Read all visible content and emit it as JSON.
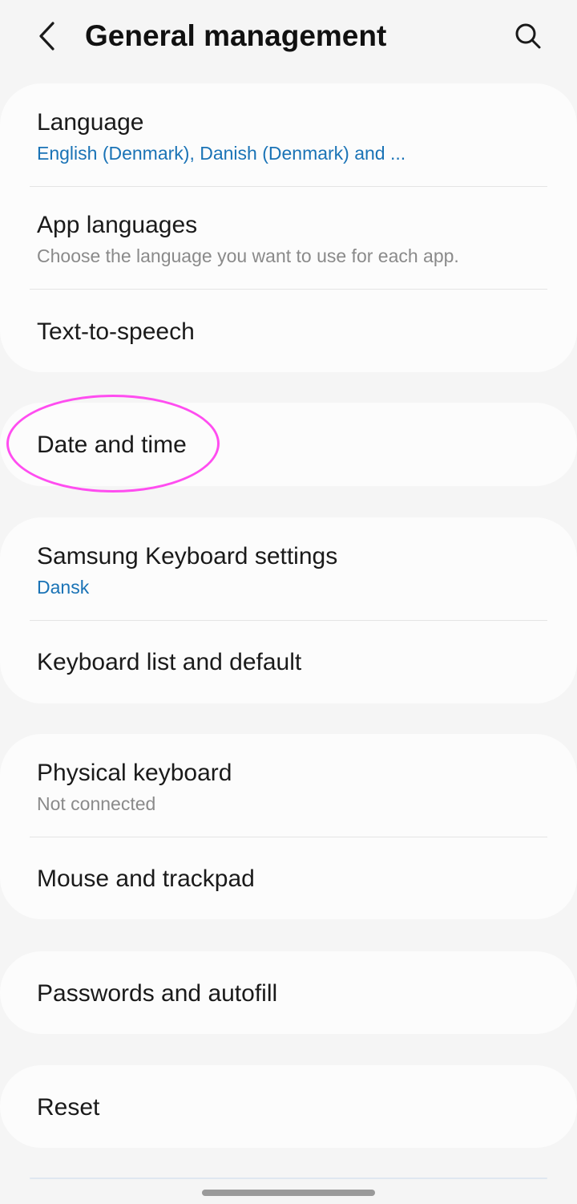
{
  "header": {
    "title": "General management",
    "back_icon": "chevron-left-icon",
    "search_icon": "search-icon"
  },
  "colors": {
    "background": "#f5f5f5",
    "card": "#fcfcfc",
    "subtitle_blue": "#1a73b6",
    "subtitle_gray": "#8a8a8a",
    "highlight": "#ff4df0"
  },
  "groups": [
    {
      "items": [
        {
          "title": "Language",
          "subtitle": "English (Denmark), Danish (Denmark) and ..."
        },
        {
          "title": "App languages",
          "subtitle": "Choose the language you want to use for each app."
        },
        {
          "title": "Text-to-speech"
        }
      ]
    },
    {
      "items": [
        {
          "title": "Date and time"
        }
      ]
    },
    {
      "items": [
        {
          "title": "Samsung Keyboard settings",
          "subtitle": "Dansk"
        },
        {
          "title": "Keyboard list and default"
        }
      ]
    },
    {
      "items": [
        {
          "title": "Physical keyboard",
          "subtitle": "Not connected"
        },
        {
          "title": "Mouse and trackpad"
        }
      ]
    },
    {
      "items": [
        {
          "title": "Passwords and autofill"
        }
      ]
    },
    {
      "items": [
        {
          "title": "Reset"
        }
      ]
    }
  ]
}
